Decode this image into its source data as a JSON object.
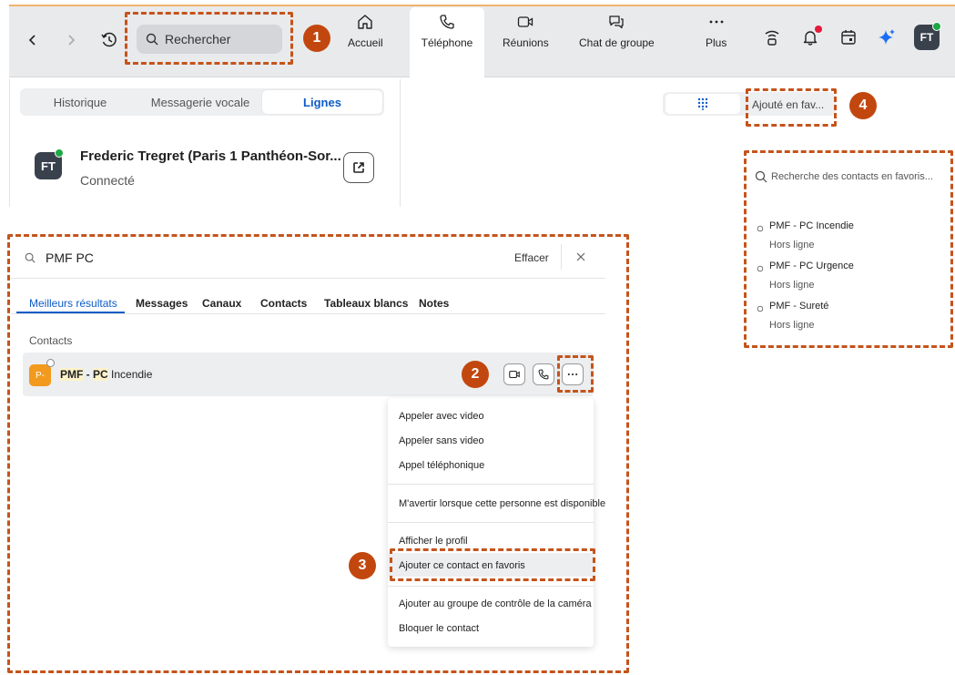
{
  "header": {
    "search_placeholder": "Rechercher",
    "tabs": [
      {
        "label": "Accueil",
        "icon": "home-icon"
      },
      {
        "label": "Téléphone",
        "icon": "phone-icon"
      },
      {
        "label": "Réunions",
        "icon": "video-icon"
      },
      {
        "label": "Chat de groupe",
        "icon": "chat-icon"
      },
      {
        "label": "Plus",
        "icon": "more-icon"
      }
    ],
    "avatar_initials": "FT"
  },
  "phone": {
    "segments": [
      "Historique",
      "Messagerie vocale",
      "Lignes"
    ],
    "active_segment": "Lignes",
    "line": {
      "initials": "FT",
      "name": "Frederic Tregret (Paris 1 Panthéon-Sor...",
      "status": "Connecté"
    }
  },
  "favorites": {
    "added_label": "Ajouté en fav...",
    "search_placeholder": "Recherche des contacts en favoris...",
    "items": [
      {
        "name": "PMF - PC Incendie",
        "status": "Hors ligne"
      },
      {
        "name": "PMF - PC Urgence",
        "status": "Hors ligne"
      },
      {
        "name": "PMF - Sureté",
        "status": "Hors ligne"
      }
    ]
  },
  "search": {
    "query": "PMF PC",
    "clear_label": "Effacer",
    "tabs": [
      "Meilleurs résultats",
      "Messages",
      "Canaux",
      "Contacts",
      "Tableaux blancs",
      "Notes"
    ],
    "active_tab": "Meilleurs résultats",
    "section_label": "Contacts",
    "result": {
      "avatar": "P-",
      "name_part1": "PMF",
      "name_sep": " - ",
      "name_part2": "PC",
      "name_rest": " Incendie"
    }
  },
  "context_menu": {
    "items": [
      "Appeler avec video",
      "Appeler sans video",
      "Appel téléphonique",
      "M'avertir lorsque cette personne est disponible",
      "Afficher le profil",
      "Ajouter ce contact en favoris",
      "Ajouter au groupe de contrôle de la caméra",
      "Bloquer le contact"
    ]
  },
  "callouts": [
    "1",
    "2",
    "3",
    "4"
  ],
  "colors": {
    "accent": "#0e5cc7",
    "callout": "#c2470f",
    "highlight_border": "#c4541c",
    "online": "#1ea846",
    "notification": "#e5193a"
  }
}
